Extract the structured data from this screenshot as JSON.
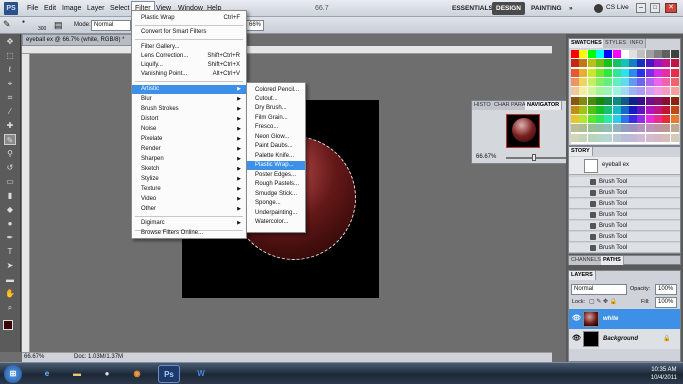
{
  "app": {
    "logo": "PS"
  },
  "menubar": {
    "items": [
      "File",
      "Edit",
      "Image",
      "Layer",
      "Select",
      "Filter",
      "View",
      "Window",
      "Help"
    ],
    "zoom": "66.7",
    "workspaces": [
      "ESSENTIALS",
      "DESIGN",
      "PAINTING"
    ],
    "more": "»",
    "cslive": "CS Live"
  },
  "options": {
    "brush_size": "300",
    "mode_label": "Mode:",
    "mode_value": "Normal",
    "zoom_field": "66%"
  },
  "document": {
    "tab": "eyeball ex @ 66.7% (white, RGB/8) *",
    "zoom": "66.67%",
    "doc_info": "Doc: 1.03M/1.37M"
  },
  "filter_menu": {
    "items": [
      {
        "label": "Plastic Wrap",
        "shortcut": "Ctrl+F"
      },
      {
        "label": "Convert for Smart Filters"
      },
      {
        "label": "Filter Gallery..."
      },
      {
        "label": "Lens Correction...",
        "shortcut": "Shift+Ctrl+R"
      },
      {
        "label": "Liquify...",
        "shortcut": "Shift+Ctrl+X"
      },
      {
        "label": "Vanishing Point...",
        "shortcut": "Alt+Ctrl+V"
      },
      {
        "label": "Artistic",
        "arrow": "▶"
      },
      {
        "label": "Blur",
        "arrow": "▶"
      },
      {
        "label": "Brush Strokes",
        "arrow": "▶"
      },
      {
        "label": "Distort",
        "arrow": "▶"
      },
      {
        "label": "Noise",
        "arrow": "▶"
      },
      {
        "label": "Pixelate",
        "arrow": "▶"
      },
      {
        "label": "Render",
        "arrow": "▶"
      },
      {
        "label": "Sharpen",
        "arrow": "▶"
      },
      {
        "label": "Sketch",
        "arrow": "▶"
      },
      {
        "label": "Stylize",
        "arrow": "▶"
      },
      {
        "label": "Texture",
        "arrow": "▶"
      },
      {
        "label": "Video",
        "arrow": "▶"
      },
      {
        "label": "Other",
        "arrow": "▶"
      },
      {
        "label": "Digimarc",
        "arrow": "▶"
      },
      {
        "label": "Browse Filters Online..."
      }
    ]
  },
  "artistic_submenu": [
    "Colored Pencil...",
    "Cutout...",
    "Dry Brush...",
    "Film Grain...",
    "Fresco...",
    "Neon Glow...",
    "Paint Daubs...",
    "Palette Knife...",
    "Plastic Wrap...",
    "Poster Edges...",
    "Rough Pastels...",
    "Smudge Stick...",
    "Sponge...",
    "Underpainting...",
    "Watercolor..."
  ],
  "navigator": {
    "tabs": [
      "HISTO",
      "CHAR",
      "PARA",
      "NAVIGATOR"
    ],
    "zoom": "66.67%"
  },
  "swatches_panel": {
    "tabs": [
      "SWATCHES",
      "STYLES",
      "INFO"
    ]
  },
  "history_panel": {
    "tab": "STORY",
    "snapshot": "eyeball ex",
    "items": [
      "Brush Tool",
      "Brush Tool",
      "Brush Tool",
      "Brush Tool",
      "Brush Tool",
      "Brush Tool",
      "Brush Tool"
    ]
  },
  "channels_tabs": [
    "CHANNELS",
    "PATHS"
  ],
  "layers_panel": {
    "tab": "LAYERS",
    "blend": "Normal",
    "opacity_label": "Opacity:",
    "opacity": "100%",
    "lock_label": "Lock:",
    "fill_label": "Fill:",
    "fill": "100%",
    "layers": [
      {
        "name": "white"
      },
      {
        "name": "Background"
      }
    ]
  },
  "taskbar": {
    "time": "10:35 AM",
    "date": "10/4/2011"
  }
}
